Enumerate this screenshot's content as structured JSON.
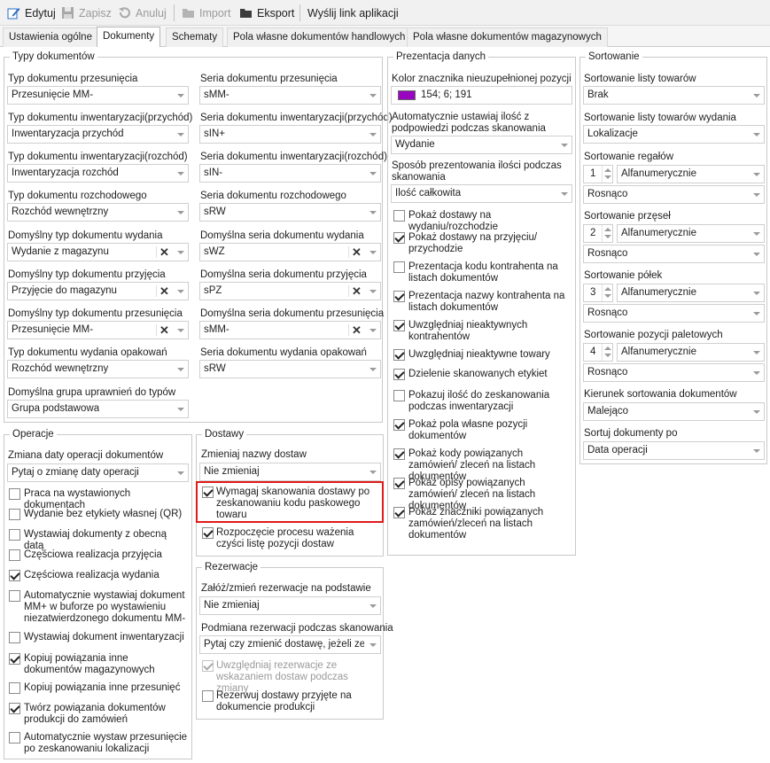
{
  "toolbar": {
    "edit": "Edytuj",
    "save": "Zapisz",
    "cancel": "Anuluj",
    "import": "Import",
    "export": "Eksport",
    "send_link": "Wyślij link aplikacji"
  },
  "tabs": [
    "Ustawienia ogólne",
    "Dokumenty",
    "Schematy",
    "Pola własne dokumentów handlowych",
    "Pola własne dokumentów magazynowych"
  ],
  "typy": {
    "title": "Typy dokumentów",
    "rows": [
      {
        "l1": "Typ dokumentu przesunięcia",
        "v1": "Przesunięcie MM-",
        "l2": "Seria dokumentu przesunięcia",
        "v2": "sMM-"
      },
      {
        "l1": "Typ dokumentu inwentaryzacji(przychód)",
        "v1": "Inwentaryzacja przychód",
        "l2": "Seria dokumentu inwentaryzacji(przychód)",
        "v2": "sIN+"
      },
      {
        "l1": "Typ dokumentu inwentaryzacji(rozchód)",
        "v1": "Inwentaryzacja rozchód",
        "l2": "Seria dokumentu inwentaryzacji(rozchód)",
        "v2": "sIN-"
      },
      {
        "l1": "Typ dokumentu rozchodowego",
        "v1": "Rozchód wewnętrzny",
        "l2": "Seria dokumentu rozchodowego",
        "v2": "sRW"
      },
      {
        "l1": "Domyślny typ dokumentu wydania",
        "v1": "Wydanie z magazynu",
        "l2": "Domyślna seria dokumentu wydania",
        "v2": "sWZ"
      },
      {
        "l1": "Domyślny typ dokumentu przyjęcia",
        "v1": "Przyjęcie do magazynu",
        "l2": "Domyślna seria dokumentu przyjęcia",
        "v2": "sPZ"
      },
      {
        "l1": "Domyślny typ dokumentu przesunięcia",
        "v1": "Przesunięcie MM-",
        "l2": "Domyślna seria dokumentu przesunięcia",
        "v2": "sMM-"
      },
      {
        "l1": "Typ dokumentu wydania opakowań",
        "v1": "Rozchód wewnętrzny",
        "l2": "Seria dokumentu wydania opakowań",
        "v2": "sRW"
      }
    ],
    "group_label": "Domyślna grupa uprawnień do typów",
    "group_value": "Grupa podstawowa"
  },
  "operacje": {
    "title": "Operacje",
    "date_label": "Zmiana daty operacji dokumentów",
    "date_value": "Pytaj o zmianę daty operacji",
    "checks": [
      {
        "text": "Praca na wystawionych dokumentach",
        "checked": false
      },
      {
        "text": "Wydanie bez etykiety własnej (QR)",
        "checked": false
      },
      {
        "text": "Wystawiaj dokumenty z obecną datą",
        "checked": false
      },
      {
        "text": "Częściowa realizacja przyjęcia",
        "checked": false
      },
      {
        "text": "Częściowa realizacja wydania",
        "checked": true
      },
      {
        "text": "Automatycznie wystawiaj dokument MM+ w buforze po wystawieniu niezatwierdzonego dokumentu MM-",
        "checked": false
      },
      {
        "text": "Wystawiaj dokument inwentaryzacji",
        "checked": false
      },
      {
        "text": "Kopiuj powiązania inne dokumentów magazynowych",
        "checked": true
      },
      {
        "text": "Kopiuj powiązania inne przesunięć",
        "checked": false
      },
      {
        "text": "Twórz powiązania dokumentów produkcji do zamówień",
        "checked": true
      },
      {
        "text": "Automatycznie wystaw przesunięcie po zeskanowaniu lokalizacji",
        "checked": false
      }
    ]
  },
  "dostawy": {
    "title": "Dostawy",
    "name_label": "Zmieniaj nazwy dostaw",
    "name_value": "Nie zmieniaj",
    "checks": [
      {
        "text": "Wymagaj skanowania dostawy po zeskanowaniu kodu paskowego towaru",
        "checked": true
      },
      {
        "text": "Rozpoczęcie procesu ważenia czyści listę pozycji dostaw",
        "checked": true
      }
    ]
  },
  "rezerwacje": {
    "title": "Rezerwacje",
    "label1": "Załóż/zmień rezerwacje na podstawie",
    "value1": "Nie zmieniaj",
    "label2": "Podmiana rezerwacji podczas skanowania",
    "value2": "Pytaj czy zmienić dostawę, jeżeli ze...",
    "checks": [
      {
        "text": "Uwzględniaj rezerwacje ze wskazaniem dostaw podczas zmiany",
        "checked": true,
        "disabled": true
      },
      {
        "text": "Rezerwuj dostawy przyjęte na dokumencie produkcji",
        "checked": false,
        "disabled": false
      }
    ]
  },
  "prezentacja": {
    "title": "Prezentacja danych",
    "color_label": "Kolor znacznika nieuzupełnionej pozycji",
    "color_value": "154; 6; 191",
    "color_hex": "#9a06bf",
    "qty_label": "Automatycznie ustawiaj ilość z podpowiedzi podczas skanowania",
    "qty_value": "Wydanie",
    "way_label": "Sposób prezentowania ilości podczas skanowania",
    "way_value": "Ilość całkowita",
    "checks": [
      {
        "text": "Pokaż dostawy na wydaniu/rozchodzie",
        "checked": false
      },
      {
        "text": "Pokaż dostawy na przyjęciu/ przychodzie",
        "checked": true
      },
      {
        "text": "Prezentacja kodu kontrahenta na listach dokumentów",
        "checked": false
      },
      {
        "text": "Prezentacja nazwy kontrahenta na listach dokumentów",
        "checked": true
      },
      {
        "text": "Uwzględniaj nieaktywnych kontrahentów",
        "checked": true
      },
      {
        "text": "Uwzględniaj nieaktywne towary",
        "checked": true
      },
      {
        "text": "Dzielenie skanowanych etykiet",
        "checked": true
      },
      {
        "text": "Pokazuj ilość do zeskanowania podczas inwentaryzacji",
        "checked": false
      },
      {
        "text": "Pokaż pola własne pozycji dokumentów",
        "checked": true
      },
      {
        "text": "Pokaż kody powiązanych zamówień/ zleceń na listach dokumentów",
        "checked": true
      },
      {
        "text": "Pokaż opisy powiązanych zamówień/ zleceń na listach dokumentów",
        "checked": true
      },
      {
        "text": "Pokaż znaczniki powiązanych zamówień/zleceń na listach dokumentów",
        "checked": true
      }
    ]
  },
  "sortowanie": {
    "title": "Sortowanie",
    "list_label": "Sortowanie listy towarów",
    "list_value": "Brak",
    "list_issue_label": "Sortowanie listy towarów wydania",
    "list_issue_value": "Lokalizacje",
    "rows": [
      {
        "label": "Sortowanie regałów",
        "num": "1",
        "mode": "Alfanumerycznie",
        "order": "Rosnąco"
      },
      {
        "label": "Sortowanie przęseł",
        "num": "2",
        "mode": "Alfanumerycznie",
        "order": "Rosnąco"
      },
      {
        "label": "Sortowanie półek",
        "num": "3",
        "mode": "Alfanumerycznie",
        "order": "Rosnąco"
      },
      {
        "label": "Sortowanie pozycji paletowych",
        "num": "4",
        "mode": "Alfanumerycznie",
        "order": "Rosnąco"
      }
    ],
    "dir_label": "Kierunek sortowania dokumentów",
    "dir_value": "Malejąco",
    "sortby_label": "Sortuj dokumenty po",
    "sortby_value": "Data operacji"
  }
}
